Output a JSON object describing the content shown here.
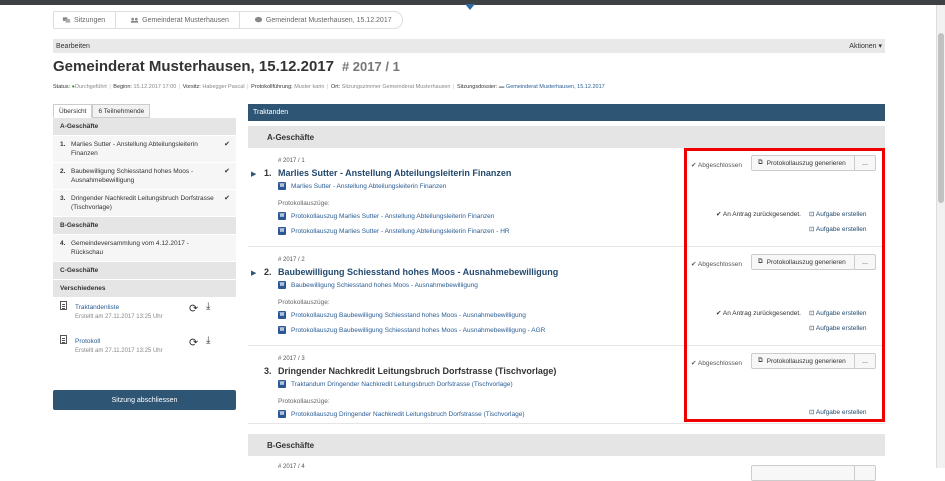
{
  "breadcrumb": [
    "Sitzungen",
    "Gemeinderat Musterhausen",
    "Gemeinderat Musterhausen, 15.12.2017"
  ],
  "editbar": {
    "left": "Bearbeiten",
    "right": "Aktionen ▾"
  },
  "header": {
    "title": "Gemeinderat Musterhausen, 15.12.2017",
    "number": "# 2017 / 1"
  },
  "meta": {
    "status_label": "Status:",
    "status_value": "Durchgeführt",
    "begin_label": "Beginn:",
    "begin_value": "15.12.2017 17:00",
    "chair_label": "Vorsitz:",
    "chair_value": "Habegger Pascal",
    "minutes_label": "Protokollführung:",
    "minutes_value": "Muster karin",
    "place_label": "Ort:",
    "place_value": "Sitzungszimmer Gemeinderat Musterhausen",
    "dossier_label": "Sitzungsdossier:",
    "dossier_value": "Gemeinderat Musterhausen, 15.12.2017"
  },
  "tabs": [
    "Übersicht",
    "6 Teilnehmende"
  ],
  "left": {
    "sections": [
      "A-Geschäfte",
      "B-Geschäfte",
      "C-Geschäfte",
      "Verschiedenes"
    ],
    "a_items": [
      {
        "n": "1.",
        "text": "Marlies Sutter - Anstellung Abteilungsleiterin Finanzen"
      },
      {
        "n": "2.",
        "text": "Baubewilligung Schiesstand hohes Moos - Ausnahmebewilligung"
      },
      {
        "n": "3.",
        "text": "Dringender Nachkredit Leitungsbruch Dorfstrasse (Tischvorlage)"
      }
    ],
    "b_items": [
      {
        "n": "4.",
        "text": "Gemeindeversammlung vom 4.12.2017 - Rückschau"
      }
    ],
    "docs": [
      {
        "title": "Traktandenliste",
        "sub": "Erstellt am 27.11.2017 13:25 Uhr"
      },
      {
        "title": "Protokoll",
        "sub": "Erstellt am 27.11.2017 13:25 Uhr"
      }
    ],
    "close_button": "Sitzung abschliessen"
  },
  "right": {
    "header": "Traktanden",
    "group_a": "A-Geschäfte",
    "group_b": "B-Geschäfte",
    "extracts_label": "Protokollauszüge:",
    "status": "Abgeschlossen",
    "gen_button": "Protokollauszug generieren",
    "more_button": "...",
    "antrag": "An Antrag zurückgesendet.",
    "aufgabe": "Aufgabe erstellen",
    "items": [
      {
        "num": "# 2017 / 1",
        "idx": "1.",
        "title": "Marlies Sutter - Anstellung Abteilungsleiterin Finanzen",
        "file": "Marlies Sutter - Anstellung Abteilungsleiterin Finanzen",
        "extracts": [
          "Protokollauszug Marlies Sutter - Anstellung Abteilungsleiterin Finanzen",
          "Protokollauszug Marlies Sutter - Anstellung Abteilungsleiterin Finanzen - HR"
        ]
      },
      {
        "num": "# 2017 / 2",
        "idx": "2.",
        "title": "Baubewilligung Schiesstand hohes Moos - Ausnahmebewilligung",
        "file": "Baubewilligung Schiesstand hohes Moos - Ausnahmebewilligung",
        "extracts": [
          "Protokollauszug Baubewilligung Schiesstand hohes Moos - Ausnahmebewilligung",
          "Protokollauszug Baubewilligung Schiesstand hohes Moos - Ausnahmebewilligung - AGR"
        ]
      },
      {
        "num": "# 2017 / 3",
        "idx": "3.",
        "title": "Dringender Nachkredit Leitungsbruch Dorfstrasse (Tischvorlage)",
        "file": "Traktandum Dringender Nachkredit Leitungsbruch Dorfstrasse (Tischvorlage)",
        "extracts": [
          "Protokollauszug Dringender Nachkredit Leitungsbruch Dorfstrasse (Tischvorlage)"
        ]
      }
    ],
    "partial_num": "# 2017 / 4"
  }
}
